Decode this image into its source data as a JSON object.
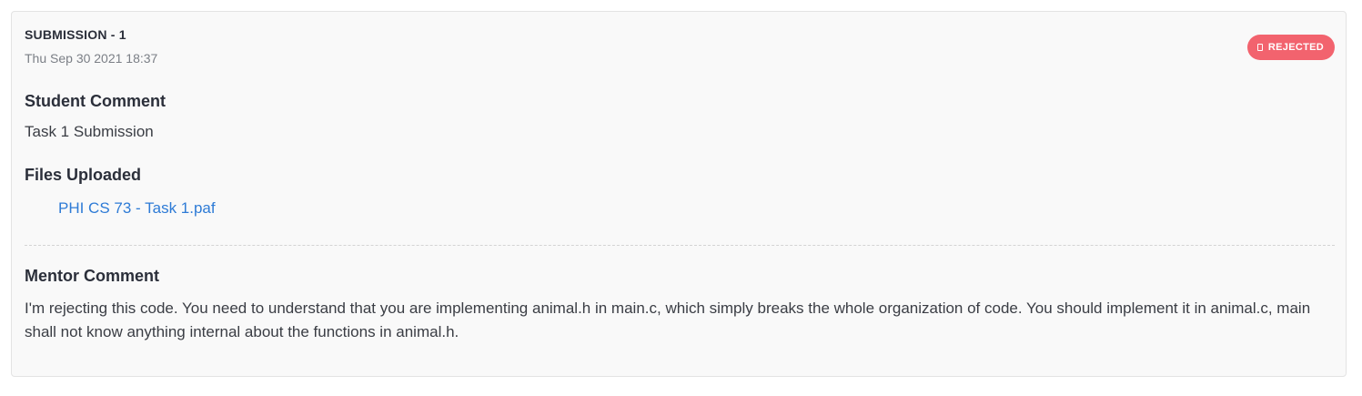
{
  "submission": {
    "title": "SUBMISSION - 1",
    "date": "Thu Sep 30 2021 18:37",
    "status": {
      "label": "REJECTED",
      "icon": "file-icon",
      "color": "#f2636e"
    }
  },
  "student_comment": {
    "heading": "Student Comment",
    "text": "Task 1 Submission"
  },
  "files": {
    "heading": "Files Uploaded",
    "items": [
      {
        "name": "PHI CS 73 - Task 1.paf"
      }
    ]
  },
  "mentor_comment": {
    "heading": "Mentor Comment",
    "text": "I'm rejecting this code.  You need to understand that you are implementing animal.h in main.c, which simply breaks the whole organization of code. You should implement it in animal.c, main shall not know anything internal about the functions in animal.h."
  }
}
